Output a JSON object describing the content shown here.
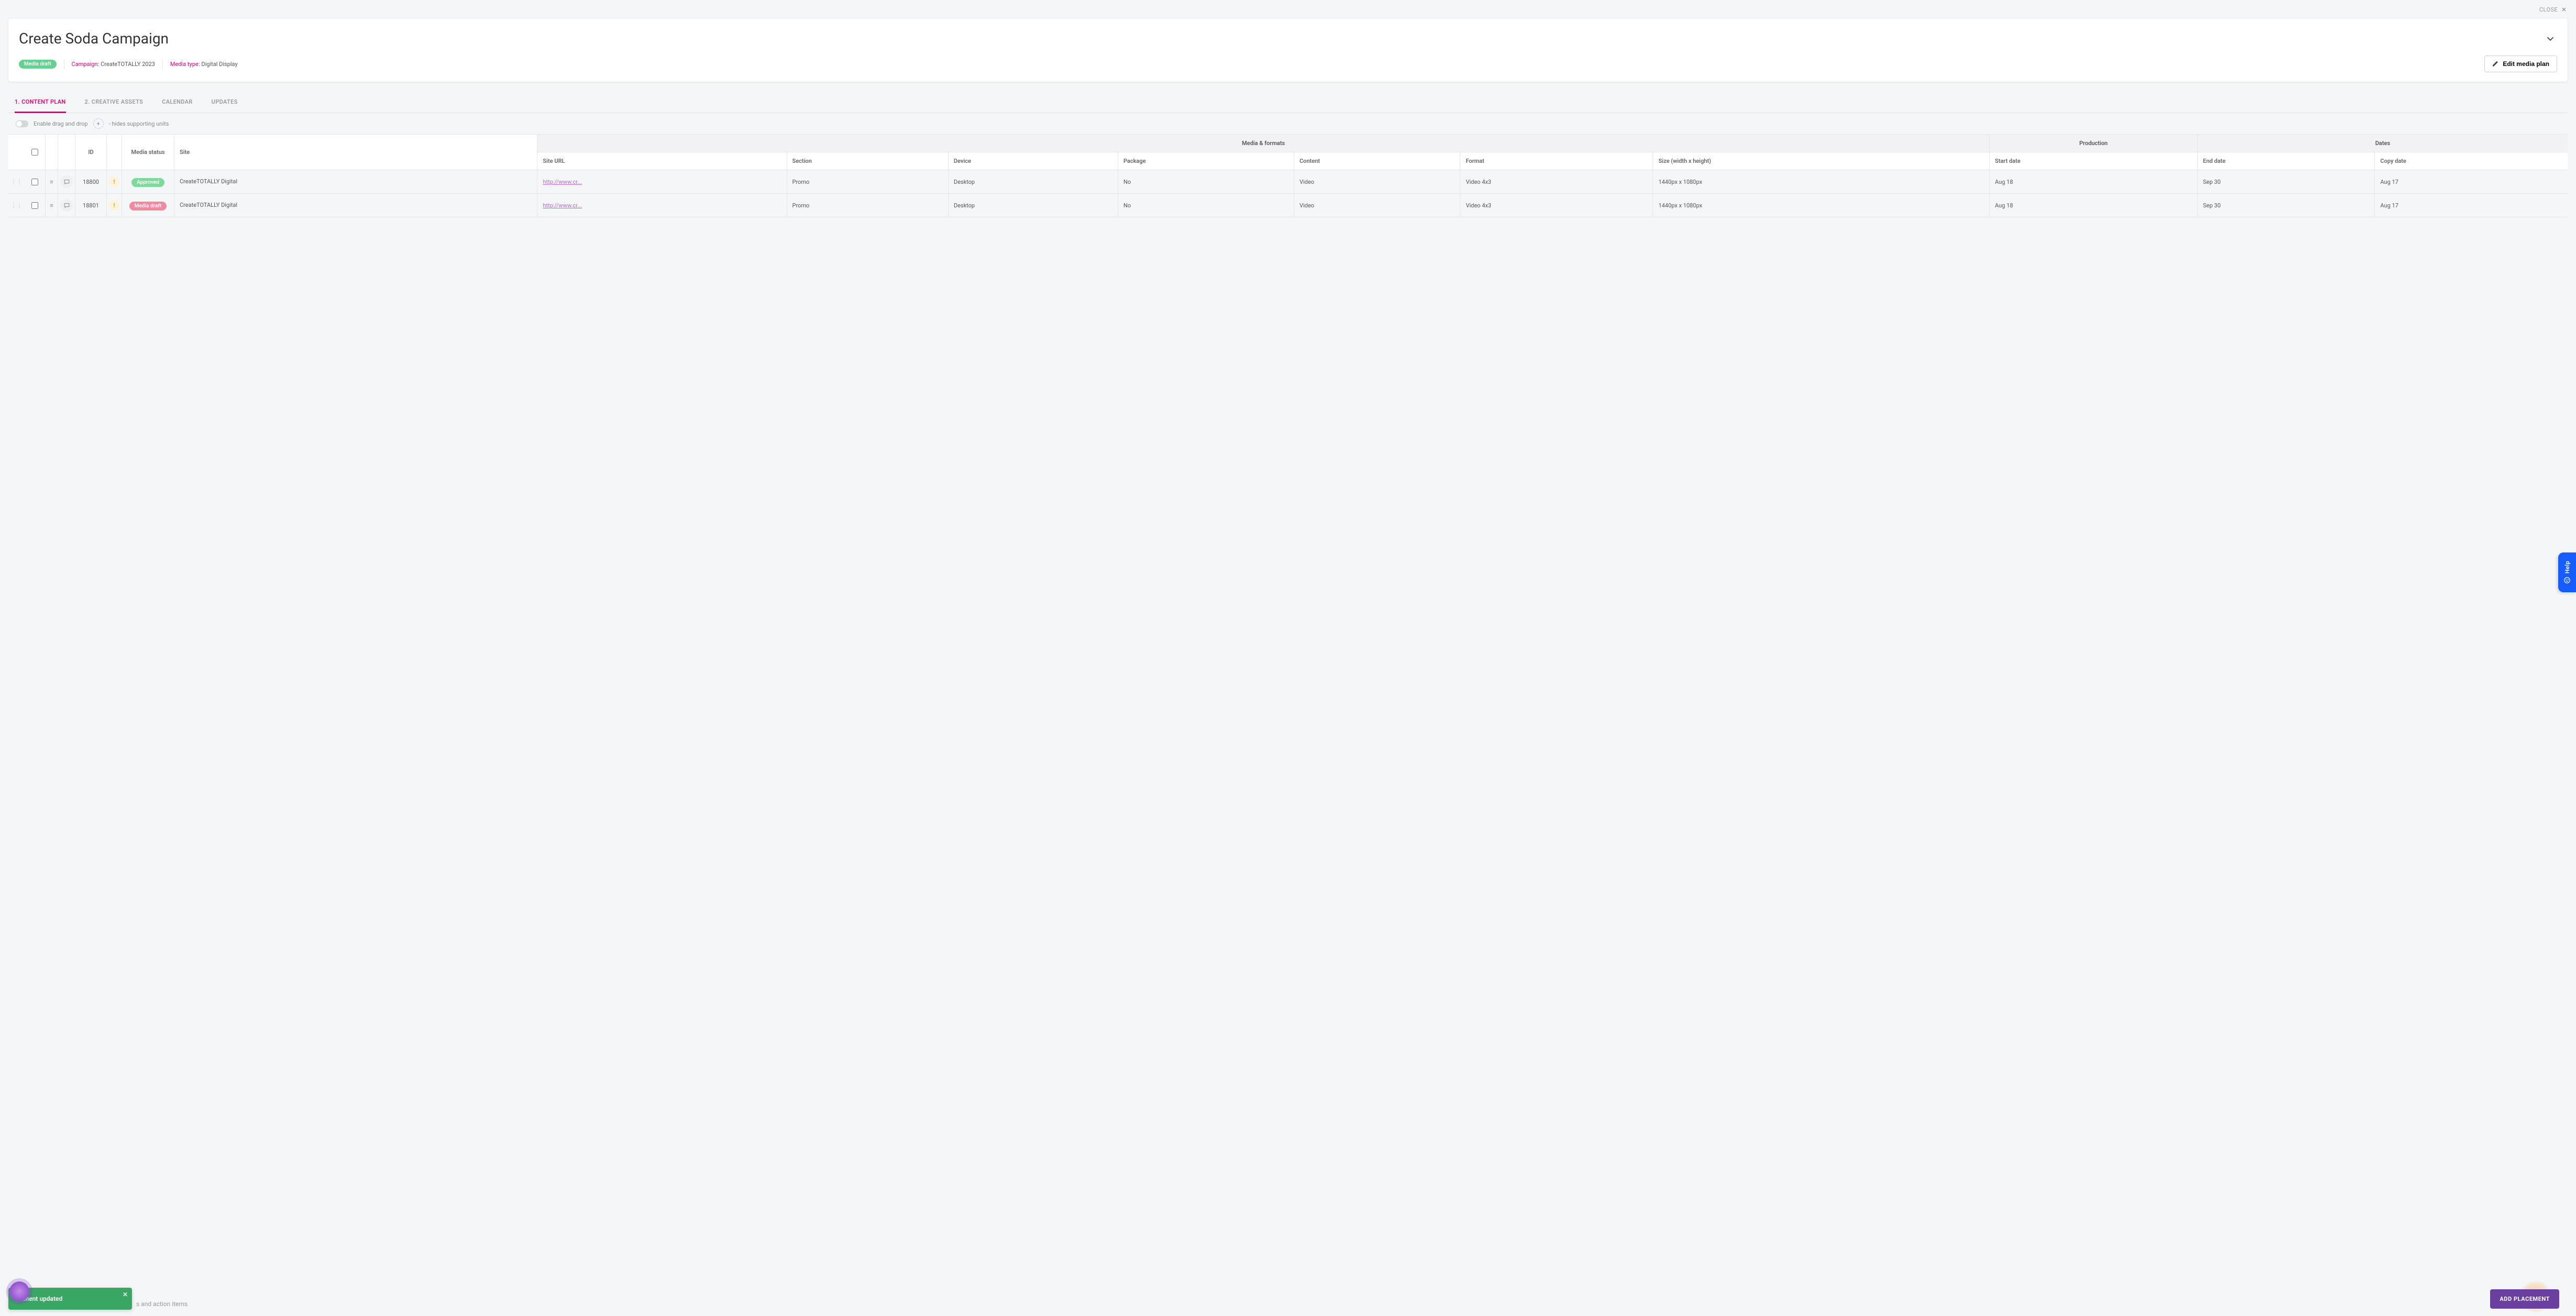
{
  "close_label": "CLOSE",
  "header": {
    "title": "Create Soda Campaign",
    "status_label": "Media draft",
    "campaign_label": "Campaign:",
    "campaign_value": "CreateTOTALLY 2023",
    "media_type_label": "Media type:",
    "media_type_value": "Digital Display",
    "edit_label": "Edit media plan"
  },
  "tabs": [
    {
      "label": "1. CONTENT PLAN",
      "active": true
    },
    {
      "label": "2. CREATIVE ASSETS",
      "active": false
    },
    {
      "label": "CALENDAR",
      "active": false
    },
    {
      "label": "UPDATES",
      "active": false
    }
  ],
  "controls": {
    "drag_label": "Enable drag and drop",
    "hides_label": "- hides supporting units"
  },
  "table": {
    "groups": {
      "media": "Media & formats",
      "production": "Production",
      "dates": "Dates"
    },
    "cols": {
      "id": "ID",
      "media_status": "Media status",
      "site": "Site",
      "site_url": "Site URL",
      "section": "Section",
      "device": "Device",
      "package": "Package",
      "content": "Content",
      "format": "Format",
      "size": "Size (width x height)",
      "start_date": "Start date",
      "end_date": "End date",
      "copy_date": "Copy date"
    },
    "rows": [
      {
        "id": "18800",
        "status_label": "Approved",
        "status_kind": "approved",
        "site": "CreateTOTALLY Digital",
        "site_url": "http://www.cr...",
        "section": "Promo",
        "device": "Desktop",
        "package": "No",
        "content": "Video",
        "format": "Video 4x3",
        "size": "1440px x 1080px",
        "start_date": "Aug 18",
        "end_date": "Sep 30",
        "copy_date": "Aug 17"
      },
      {
        "id": "18801",
        "status_label": "Media draft",
        "status_kind": "red",
        "site": "CreateTOTALLY Digital",
        "site_url": "http://www.cr...",
        "section": "Promo",
        "device": "Desktop",
        "package": "No",
        "content": "Video",
        "format": "Video 4x3",
        "size": "1440px x 1080px",
        "start_date": "Aug 18",
        "end_date": "Sep 30",
        "copy_date": "Aug 17"
      }
    ]
  },
  "help_label": "Help",
  "toast": "cement updated",
  "footer_hint": "s and action items",
  "add_placement": "ADD PLACEMENT"
}
